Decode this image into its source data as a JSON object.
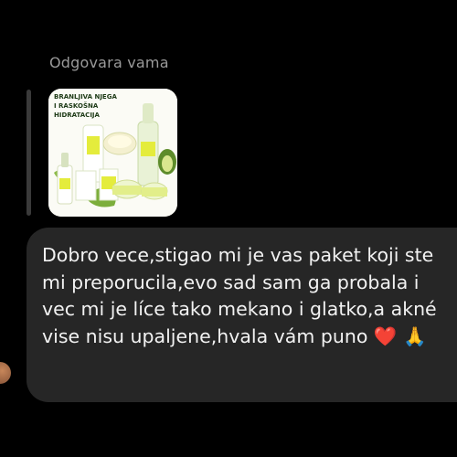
{
  "reply": {
    "header": "Odgovara vama"
  },
  "shared_image": {
    "text_lines": [
      "BRANLJIVA NJEGA",
      "I RASKOŠNA",
      "HIDRATACIJA"
    ]
  },
  "message": {
    "text": "Dobro vece,stigao mi je vas paket koji ste mi preporucila,evo sad sam ga probala i vec mi je líce tako mekano i glatko,a akné vise nisu upaljene,hvala vám puno ❤️ 🙏"
  },
  "colors": {
    "background": "#000000",
    "bubble": "#262626",
    "message_text": "#f2f2f2",
    "header_text": "#9a9a9a",
    "quote_bar": "#3a3a3a"
  }
}
